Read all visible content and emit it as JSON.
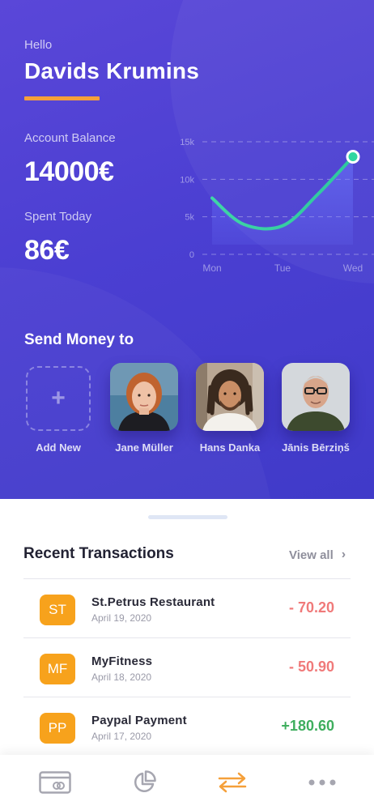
{
  "header": {
    "greeting": "Hello",
    "username": "Davids Krumins"
  },
  "balance": {
    "label": "Account Balance",
    "value": "14000€"
  },
  "spent": {
    "label": "Spent Today",
    "value": "86€"
  },
  "chart_data": {
    "type": "area",
    "x": [
      "Mon",
      "Tue",
      "Wed"
    ],
    "y_ticks": [
      "15k",
      "10k",
      "5k",
      "0"
    ],
    "ylim": [
      0,
      15000
    ],
    "curve_points": [
      [
        0,
        7500
      ],
      [
        0.45,
        4000
      ],
      [
        1.0,
        3800
      ],
      [
        1.5,
        8000
      ],
      [
        2.0,
        13000
      ]
    ],
    "title": "",
    "xlabel": "",
    "ylabel": "",
    "line_color": "#2fd6a0",
    "grid": "dashed horizontal"
  },
  "send": {
    "title": "Send Money to",
    "contacts": [
      {
        "label": "Add New"
      },
      {
        "label": "Jane Müller"
      },
      {
        "label": "Hans Danka"
      },
      {
        "label": "Jānis Bērziņš"
      }
    ]
  },
  "transactions": {
    "title": "Recent Transactions",
    "view_all": "View all",
    "items": [
      {
        "initials": "ST",
        "name": "St.Petrus Restaurant",
        "date": "April 19, 2020",
        "amount": "- 70.20"
      },
      {
        "initials": "MF",
        "name": "MyFitness",
        "date": "April 18, 2020",
        "amount": "- 50.90"
      },
      {
        "initials": "PP",
        "name": "Paypal Payment",
        "date": "April 17, 2020",
        "amount": "+180.60"
      }
    ]
  },
  "tabbar": {
    "icons": [
      "card-icon",
      "pie-chart-icon",
      "transfer-icon",
      "more-icon"
    ],
    "active_color": "#f5a03a"
  },
  "colors": {
    "accent": "#f5a03a",
    "background": "#4b3fd2",
    "negative": "#f07a7a",
    "positive": "#3fae5e"
  }
}
